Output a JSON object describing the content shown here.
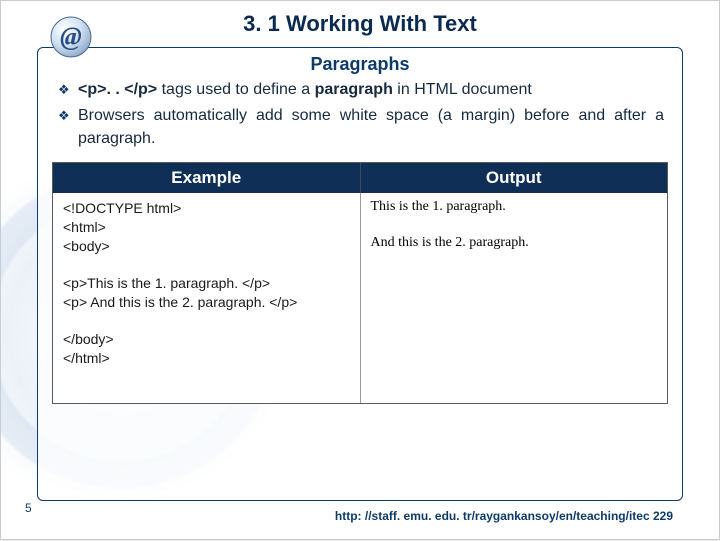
{
  "title": "3. 1 Working With Text",
  "subtitle": "Paragraphs",
  "bullets": {
    "b1_pre": "<p>. . </p>",
    "b1_mid": " tags used to define a ",
    "b1_kw": "paragraph",
    "b1_post": " in HTML document",
    "b2": "Browsers automatically add some white space (a margin) before and after a paragraph."
  },
  "table": {
    "h1": "Example",
    "h2": "Output",
    "code1": "<!DOCTYPE html>\n<html>\n<body>",
    "code2": "<p>This is the 1. paragraph. </p>\n<p> And this is the 2. paragraph. </p>",
    "code3": "</body>\n</html>",
    "out1": "This is the 1. paragraph.",
    "out2": "And this is the 2. paragraph."
  },
  "pagenum": "5",
  "footer": "http: //staff. emu. edu. tr/raygankansoy/en/teaching/itec 229"
}
